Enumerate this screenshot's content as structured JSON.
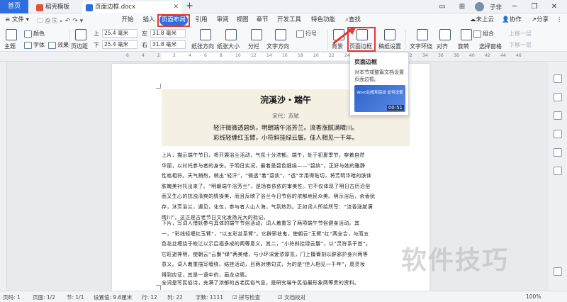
{
  "titlebar": {
    "home": "首页",
    "tabs": [
      {
        "label": "稻壳模板",
        "color": "#e2533a"
      },
      {
        "label": "页面边框.docx",
        "color": "#2f6de1"
      }
    ],
    "plus": "+",
    "user": "子非",
    "count_badge": "1"
  },
  "menubar": {
    "file": "文件",
    "items": [
      "开始",
      "插入",
      "页面布局",
      "引用",
      "审阅",
      "视图",
      "章节",
      "开发工具",
      "特色功能"
    ],
    "active": "页面布局",
    "search": "查找",
    "unsaved": "未上云",
    "collab": "协作",
    "share": "分享"
  },
  "ribbon": {
    "theme": "主题",
    "colors": "颜色",
    "fonts": "字体",
    "effects": "效果",
    "margins": "页边距",
    "top_label": "上",
    "bottom_label": "下",
    "left_label": "左",
    "right_label": "右",
    "top_value": "25.4 毫米",
    "bottom_value": "25.4 毫米",
    "left_value": "31.8 毫米",
    "right_value": "31.8 毫米",
    "orientation": "纸张方向",
    "size": "纸张大小",
    "columns": "分栏",
    "text_direction": "文字方向",
    "line_numbers": "行号",
    "background": "背景",
    "page_border": "页面边框",
    "draft_paper": "稿纸设置",
    "text_wrap": "文字环绕",
    "align": "对齐",
    "rotate": "旋转",
    "group": "组合",
    "select_pane": "选择窗格",
    "bring_forward": "上移一层",
    "send_backward": "下移一层"
  },
  "tooltip": {
    "title": "页面边框",
    "desc": "对本节或整篇文档设置页面边框。",
    "video_caption": "Word边框和底纹 如何设置",
    "duration": "00:51"
  },
  "ruler_numbers": [
    "6",
    "4",
    "2",
    "2",
    "4",
    "6",
    "8",
    "10",
    "12",
    "14",
    "16",
    "18",
    "20",
    "22",
    "24",
    "26",
    "28",
    "30",
    "32",
    "34",
    "36",
    "38",
    "40",
    "42",
    "44",
    "46"
  ],
  "doc": {
    "poem_title": "浣溪沙・端午",
    "poem_author": "宋代：苏轼",
    "poem_line1": "轻汗微微透碧纨，明朝端午浴芳兰。流香涨腻满晴川。",
    "poem_line2": "彩线轻缠红玉臂，小符斜挂绿云鬟。佳人相见一千年。",
    "para1": [
      "上片，描示端午节日，将开展浴兰活动，气氛十分浓郁。端午，处于初夏季节，穿着自然",
      "华丽，以衬托参与者的身份。于明日实况，最着是碧色细绢——“碧纨”，正好与她的雅静",
      "性格相符。天气稍热，稍出“轻汗”，“微透”着“碧纨”，“透”字用得贴切，将芳明华暗的肤体",
      "肤魄美衬托出来了。“明朝端午浴芳兰”，是场有依依的审美性。它不仅体现了明日古历沿俗",
      "而又生心的抗浊清爽的情操美，而且反映了浴兰今日节俗的浓郁地民众美。明示浴后，余香犹",
      "存，沐芳浴兰，遇见，化仅，参与者人山人海，气氛热烈。正如词人所绘所写：“流香涨腻满",
      "晴川”。这正是古老节日文化发扬光大的标记。"
    ],
    "para2": [
      "下片，写词人借妖参与具体的端午节俗活动。词人着重写了两项端午节俗健身活动。其",
      "一，“彩线轻缠红玉臂”，“以五彩丝系臂”。它辟邪祛鬼，使朝云“玉臂”红”两全合，与而五",
      "色花丝缠绕于皎江以示后福多成的两等意义。其二，“小符斜挂绿云鬟”，以“灵符系于首”。",
      "它旺避神明，使朝云“云鬟”绿”两美绪，与小环深爱浓厚氛，门上檀膏刻以辟邪护身兴两等",
      "意义。词人着重描写缠绕、结挂活动，且两对佛句式，为的是“佳人相见一千年”，愿灵妆",
      "得到应证，其是一语中的，画龙点睛。"
    ],
    "para3": "全词是写民俗诗，充满了浓郁的古老民俗气息，是研究端午民俗最形象两等贵的资料。"
  },
  "statusbar": {
    "page_num": "页码: 1",
    "pages": "页面: 1/2",
    "section": "节: 1/1",
    "setting": "设置值: 9.6厘米",
    "row": "行: 12",
    "col": "列: 22",
    "words": "字数: 1111",
    "spell": "拼写检查",
    "proofread": "文档校对",
    "zoom": "100%"
  },
  "watermark": "软件技巧",
  "colors": {
    "accent": "#2f6de1",
    "highlight_red": "#e53935",
    "poem_bg": "#f4f0e3"
  }
}
